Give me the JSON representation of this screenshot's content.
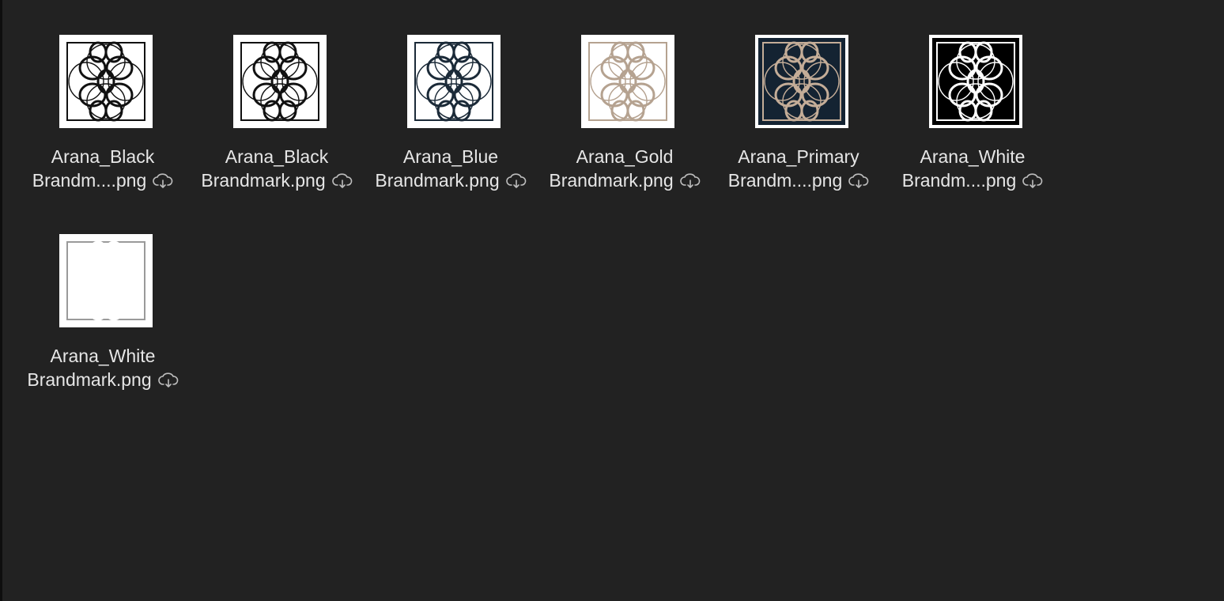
{
  "files": [
    {
      "line1": "Arana_Black",
      "line2": "Brandm....png",
      "icon": "cloud-download-icon",
      "bg": "#ffffff",
      "stroke": "#111111",
      "border": "#111111"
    },
    {
      "line1": "Arana_Black",
      "line2": "Brandmark.png",
      "icon": "cloud-download-icon",
      "bg": "#ffffff",
      "stroke": "#111111",
      "border": "#111111"
    },
    {
      "line1": "Arana_Blue",
      "line2": "Brandmark.png",
      "icon": "cloud-download-icon",
      "bg": "#ffffff",
      "stroke": "#1b2a38",
      "border": "#1b2a38"
    },
    {
      "line1": "Arana_Gold",
      "line2": "Brandmark.png",
      "icon": "cloud-download-icon",
      "bg": "#ffffff",
      "stroke": "#b5a290",
      "border": "#b5a290"
    },
    {
      "line1": "Arana_Primary",
      "line2": "Brandm....png",
      "icon": "cloud-download-icon",
      "bg": "#142332",
      "stroke": "#c4ad98",
      "border": "#c4ad98"
    },
    {
      "line1": "Arana_White",
      "line2": "Brandm....png",
      "icon": "cloud-download-icon",
      "bg": "#000000",
      "stroke": "#ffffff",
      "border": "#ffffff"
    },
    {
      "line1": "Arana_White",
      "line2": "Brandmark.png",
      "icon": "cloud-download-icon",
      "bg": "#ffffff",
      "stroke": "#ffffff",
      "border": "#9a9a9a"
    }
  ]
}
